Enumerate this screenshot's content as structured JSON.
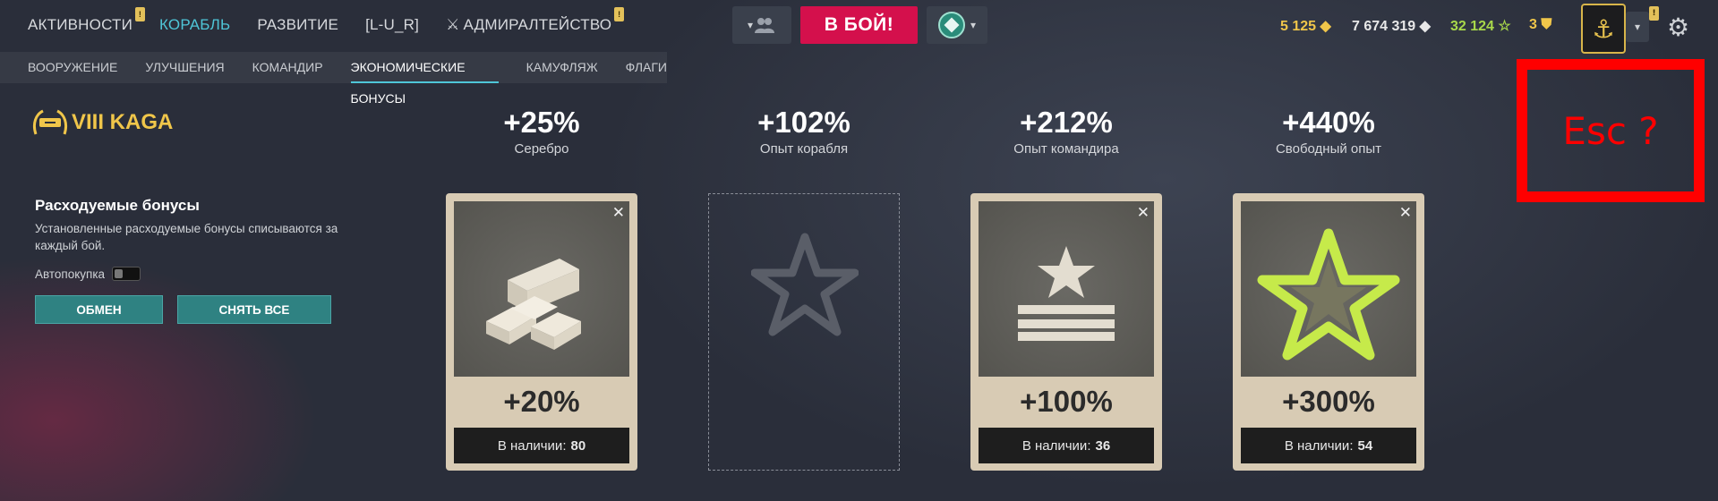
{
  "nav": {
    "activities": "АКТИВНОСТИ",
    "ship": "КОРАБЛЬ",
    "development": "РАЗВИТИЕ",
    "clan_tag": "[L-U_R]",
    "admiralty": "АДМИРАЛТЕЙСТВО"
  },
  "battle_button": "В БОЙ!",
  "currencies": {
    "doubloons": "5 125",
    "credits": "7 674 319",
    "free_xp": "32 124",
    "tokens": "3"
  },
  "colors": {
    "accent": "#4fc6d8",
    "battle": "#d4104c",
    "gold": "#f0c64a",
    "free_xp": "#a8d84a",
    "teal_button": "#2f8282"
  },
  "subnav": [
    "ВООРУЖЕНИЕ",
    "УЛУЧШЕНИЯ",
    "КОМАНДИР",
    "ЭКОНОМИЧЕСКИЕ БОНУСЫ",
    "КАМУФЛЯЖ",
    "ФЛАГИ"
  ],
  "ship": {
    "tier_name": "VIII KAGA"
  },
  "consumables": {
    "title": "Расходуемые бонусы",
    "description": "Установленные расходуемые бонусы списываются за каждый бой.",
    "autobuy_label": "Автопокупка",
    "exchange_button": "ОБМЕН",
    "remove_all_button": "СНЯТЬ ВСЕ"
  },
  "totals": [
    {
      "value": "+25%",
      "label": "Серебро"
    },
    {
      "value": "+102%",
      "label": "Опыт корабля"
    },
    {
      "value": "+212%",
      "label": "Опыт командира"
    },
    {
      "value": "+440%",
      "label": "Свободный опыт"
    }
  ],
  "cards": [
    {
      "icon": "silver-bars-icon",
      "value": "+20%",
      "stock_label": "В наличии:",
      "stock": "80"
    },
    {
      "icon": "empty-slot-star-icon"
    },
    {
      "icon": "commander-xp-icon",
      "value": "+100%",
      "stock_label": "В наличии:",
      "stock": "36"
    },
    {
      "icon": "free-xp-star-icon",
      "value": "+300%",
      "stock_label": "В наличии:",
      "stock": "54"
    }
  ],
  "esc_hint": "Esc ?"
}
